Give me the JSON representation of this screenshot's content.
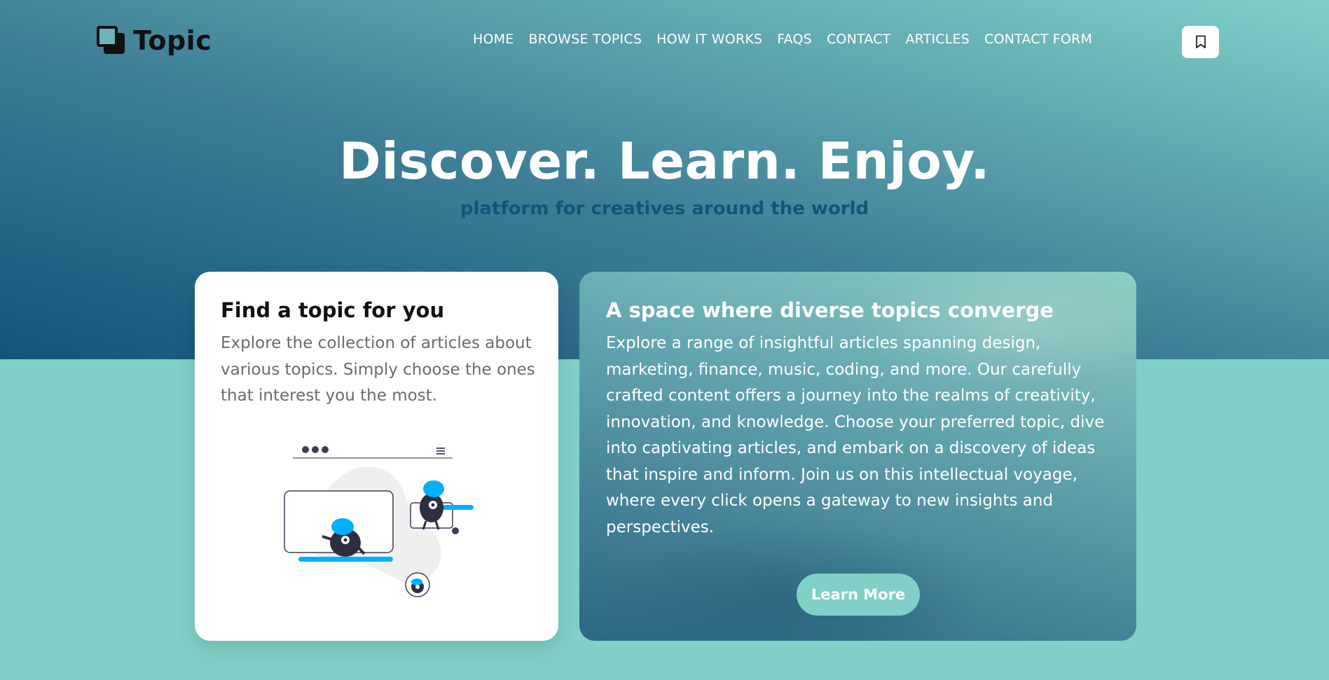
{
  "brand": {
    "name": "Topic"
  },
  "nav": {
    "items": [
      "HOME",
      "BROWSE TOPICS",
      "HOW IT WORKS",
      "FAQS",
      "CONTACT",
      "ARTICLES",
      "CONTACT FORM"
    ]
  },
  "hero": {
    "title": "Discover. Learn. Enjoy.",
    "subtitle": "platform for creatives around the world"
  },
  "card_left": {
    "title": "Find a topic for you",
    "text": "Explore the collection of articles about various topics. Simply choose the ones that interest you the most."
  },
  "card_right": {
    "title": "A space where diverse topics converge",
    "text": "Explore a range of insightful articles spanning design, marketing, finance, music, coding, and more. Our carefully crafted content offers a journey into the realms of creativity, innovation, and knowledge. Choose your preferred topic, dive into captivating articles, and embark on a discovery of ideas that inspire and inform. Join us on this intellectual voyage, where every click opens a gateway to new insights and perspectives.",
    "button": "Learn More"
  },
  "colors": {
    "primary": "#13547a",
    "secondary": "#80d0c7",
    "white": "#ffffff"
  },
  "icons": {
    "brand": "stacked-squares-icon",
    "bookmark": "bookmark-icon"
  }
}
